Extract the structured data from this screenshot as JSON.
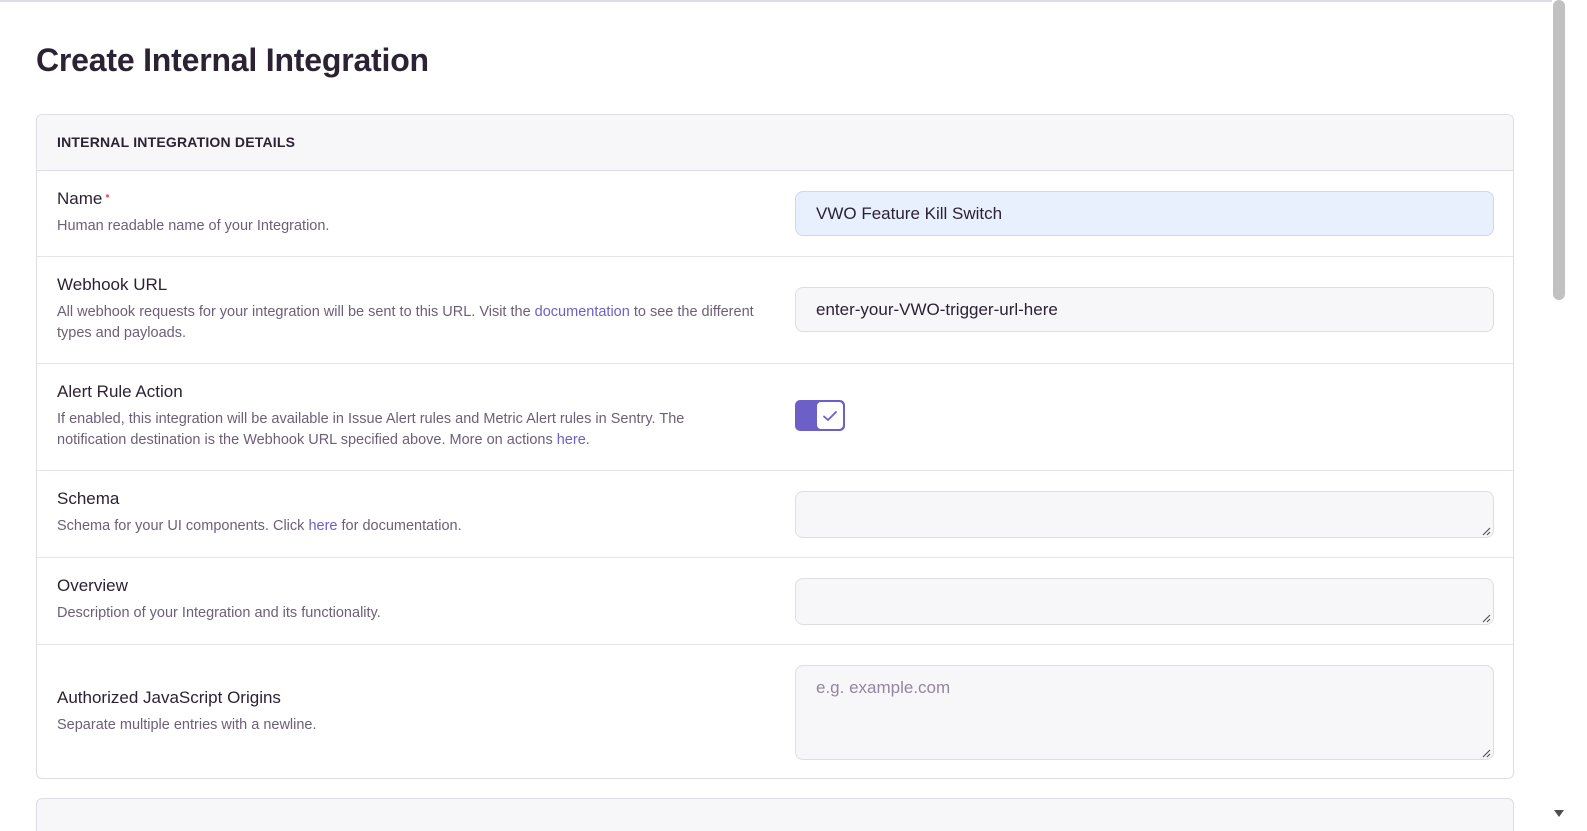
{
  "page": {
    "title": "Create Internal Integration"
  },
  "details": {
    "header": "INTERNAL INTEGRATION DETAILS",
    "name": {
      "label": "Name",
      "required_mark": "•",
      "help": "Human readable name of your Integration.",
      "value": "VWO Feature Kill Switch"
    },
    "webhook": {
      "label": "Webhook URL",
      "help_prefix": "All webhook requests for your integration will be sent to this URL. Visit the ",
      "help_link": "documentation",
      "help_suffix": " to see the different types and payloads.",
      "value": "enter-your-VWO-trigger-url-here"
    },
    "alert_rule": {
      "label": "Alert Rule Action",
      "help_prefix": "If enabled, this integration will be available in Issue Alert rules and Metric Alert rules in Sentry. The notification destination is the Webhook URL specified above. More on actions ",
      "help_link": "here",
      "help_suffix": ".",
      "enabled": true
    },
    "schema": {
      "label": "Schema",
      "help_prefix": "Schema for your UI components. Click ",
      "help_link": "here",
      "help_suffix": " for documentation.",
      "value": ""
    },
    "overview": {
      "label": "Overview",
      "help": "Description of your Integration and its functionality.",
      "value": ""
    },
    "origins": {
      "label": "Authorized JavaScript Origins",
      "help": "Separate multiple entries with a newline.",
      "placeholder": "e.g. example.com"
    }
  },
  "colors": {
    "accent": "#6c5fc7",
    "required": "#f55459",
    "autofill": "#e8f0fe"
  }
}
